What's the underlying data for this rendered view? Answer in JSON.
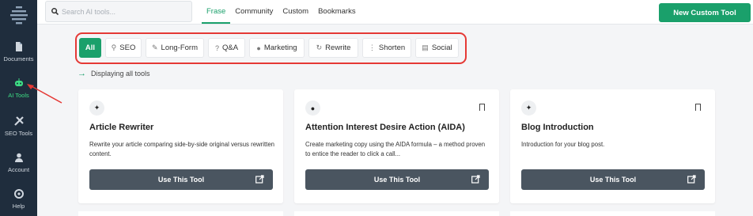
{
  "sidebar": {
    "items": [
      {
        "label": "Documents",
        "icon": "document-icon"
      },
      {
        "label": "AI Tools",
        "icon": "robot-icon",
        "active": true
      },
      {
        "label": "SEO Tools",
        "icon": "tools-icon"
      },
      {
        "label": "Account",
        "icon": "user-icon"
      },
      {
        "label": "Help",
        "icon": "help-icon"
      }
    ]
  },
  "topbar": {
    "search_placeholder": "Search AI tools...",
    "tabs": [
      "Frase",
      "Community",
      "Custom",
      "Bookmarks"
    ],
    "active_tab": "Frase",
    "new_tool_label": "New Custom Tool"
  },
  "filters": {
    "chips": [
      {
        "label": "All",
        "icon": ""
      },
      {
        "label": "SEO",
        "icon": "search-icon"
      },
      {
        "label": "Long-Form",
        "icon": "pencil-icon"
      },
      {
        "label": "Q&A",
        "icon": "question-icon"
      },
      {
        "label": "Marketing",
        "icon": "bulb-icon"
      },
      {
        "label": "Rewrite",
        "icon": "refresh-icon"
      },
      {
        "label": "Shorten",
        "icon": "compress-icon"
      },
      {
        "label": "Social",
        "icon": "share-icon"
      }
    ],
    "active": "All",
    "highlight_color": "#e53935"
  },
  "status_text": "Displaying all tools",
  "cards": [
    {
      "title": "Article Rewriter",
      "description": "Rewrite your article comparing side-by-side original versus rewritten content.",
      "button": "Use This Tool",
      "icon": "magic-wand-icon",
      "bookmark": false
    },
    {
      "title": "Attention Interest Desire Action (AIDA)",
      "description": "Create marketing copy using the AIDA formula – a method proven to entice the reader to click a call...",
      "button": "Use This Tool",
      "icon": "bulb-icon",
      "bookmark": true
    },
    {
      "title": "Blog Introduction",
      "description": "Introduction for your blog post.",
      "button": "Use This Tool",
      "icon": "magic-wand-icon",
      "bookmark": true
    }
  ],
  "colors": {
    "accent": "#1aa06b",
    "sidebar": "#1f2d3d",
    "button_dark": "#4a5560"
  }
}
